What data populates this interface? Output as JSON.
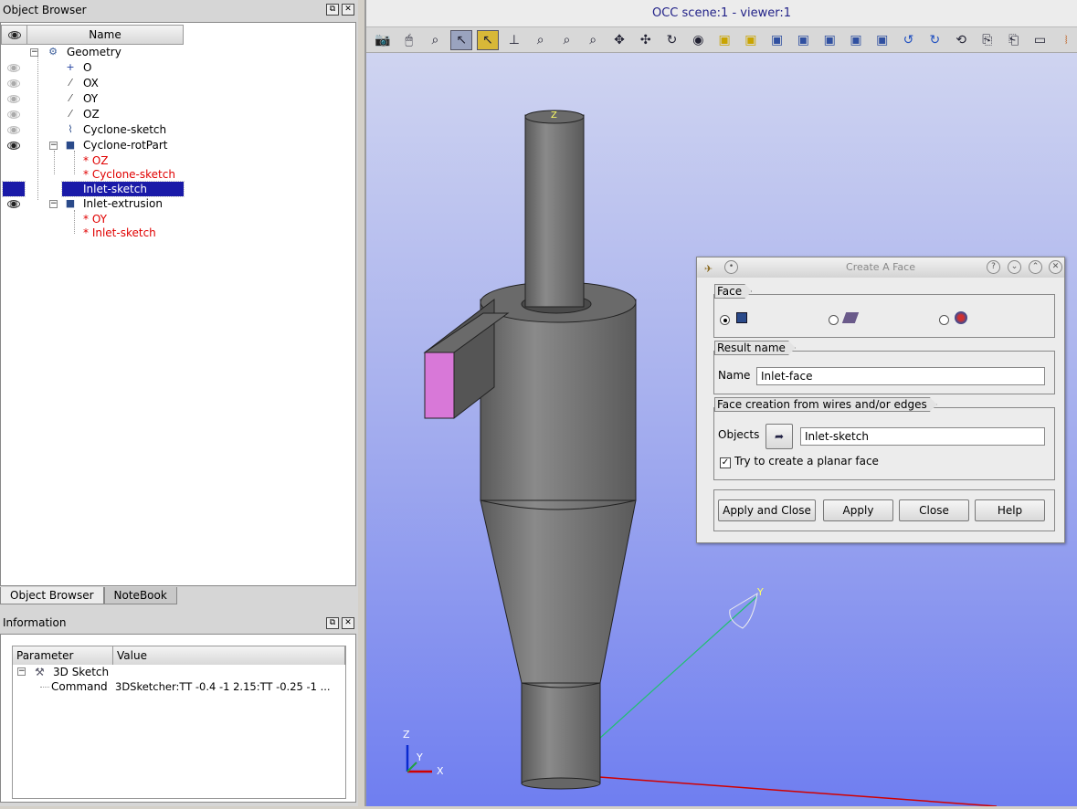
{
  "object_browser": {
    "title": "Object Browser",
    "header_name": "Name",
    "tree": [
      {
        "label": "Geometry",
        "visible": null,
        "color": "black"
      },
      {
        "label": "O",
        "visible": false,
        "color": "black"
      },
      {
        "label": "OX",
        "visible": false,
        "color": "black"
      },
      {
        "label": "OY",
        "visible": false,
        "color": "black"
      },
      {
        "label": "OZ",
        "visible": false,
        "color": "black"
      },
      {
        "label": "Cyclone-sketch",
        "visible": false,
        "color": "black"
      },
      {
        "label": "Cyclone-rotPart",
        "visible": true,
        "color": "black"
      },
      {
        "label": "* OZ",
        "visible": null,
        "color": "red"
      },
      {
        "label": "* Cyclone-sketch",
        "visible": null,
        "color": "red"
      },
      {
        "label": "Inlet-sketch",
        "visible": null,
        "color": "selected"
      },
      {
        "label": "Inlet-extrusion",
        "visible": true,
        "color": "black"
      },
      {
        "label": "* OY",
        "visible": null,
        "color": "red"
      },
      {
        "label": "* Inlet-sketch",
        "visible": null,
        "color": "red"
      }
    ],
    "tabs": [
      "Object Browser",
      "NoteBook"
    ]
  },
  "information": {
    "title": "Information",
    "columns": [
      "Parameter",
      "Value"
    ],
    "rows": [
      {
        "param": "3D Sketch",
        "value": ""
      },
      {
        "param": "Command",
        "value": "3DSketcher:TT -0.4 -1 2.15:TT -0.25 -1 ..."
      }
    ]
  },
  "viewer": {
    "title": "OCC scene:1 - viewer:1",
    "axis_labels": {
      "z": "Z",
      "y": "Y",
      "x": "X"
    }
  },
  "dialog": {
    "title": "Create A Face",
    "group_face": "Face",
    "group_result": "Result name",
    "name_label": "Name",
    "name_value": "Inlet-face",
    "group_creation": "Face creation from wires and/or edges",
    "objects_label": "Objects",
    "objects_value": "Inlet-sketch",
    "planar_checkbox": "Try to create a planar face",
    "planar_checked": true,
    "buttons": {
      "apply_close": "Apply and Close",
      "apply": "Apply",
      "close": "Close",
      "help": "Help"
    }
  },
  "colors": {
    "inlet_face": "#d878d8",
    "shape": "#6e6e6e",
    "selection": "#1a1aa8"
  }
}
